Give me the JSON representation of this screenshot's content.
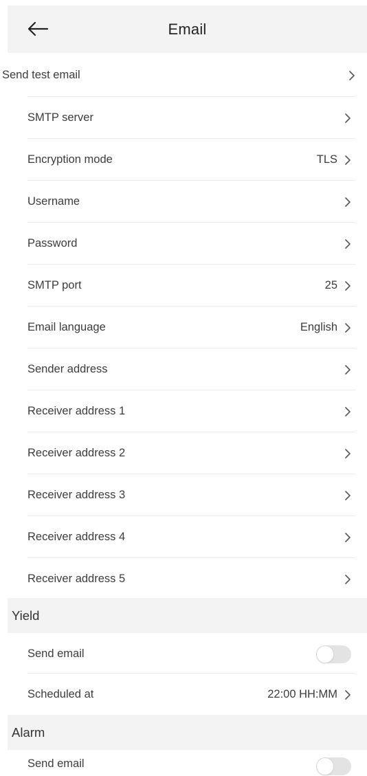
{
  "header": {
    "title": "Email",
    "back_icon": "arrow-left-icon"
  },
  "rows": [
    {
      "label": "Send test email",
      "value": ""
    },
    {
      "label": "SMTP server",
      "value": ""
    },
    {
      "label": "Encryption mode",
      "value": "TLS"
    },
    {
      "label": "Username",
      "value": ""
    },
    {
      "label": "Password",
      "value": ""
    },
    {
      "label": "SMTP port",
      "value": "25"
    },
    {
      "label": "Email language",
      "value": "English"
    },
    {
      "label": "Sender address",
      "value": ""
    },
    {
      "label": "Receiver address 1",
      "value": ""
    },
    {
      "label": "Receiver address 2",
      "value": ""
    },
    {
      "label": "Receiver address 3",
      "value": ""
    },
    {
      "label": "Receiver address 4",
      "value": ""
    },
    {
      "label": "Receiver address 5",
      "value": ""
    }
  ],
  "yield": {
    "title": "Yield",
    "send_email": {
      "label": "Send email",
      "enabled": false
    },
    "scheduled_at": {
      "label": "Scheduled at",
      "value": "22:00 HH:MM"
    }
  },
  "alarm": {
    "title": "Alarm",
    "send_email": {
      "label": "Send email",
      "enabled": false
    }
  },
  "colors": {
    "header_bg": "#f3f3f3",
    "toggle_off": "#e3e3e3",
    "text": "#3c3c3c"
  }
}
